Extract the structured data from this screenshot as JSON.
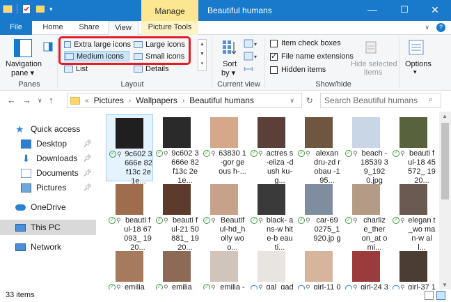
{
  "window": {
    "manage_tab": "Manage",
    "title": "Beautiful humans",
    "minimize": "—",
    "maximize": "☐",
    "close": "✕"
  },
  "tabs": {
    "file": "File",
    "home": "Home",
    "share": "Share",
    "view": "View",
    "picture_tools": "Picture Tools"
  },
  "ribbon": {
    "navigation_pane": "Navigation",
    "navigation_pane_2": "pane ▾",
    "panes_group": "Panes",
    "layout_items": {
      "extra_large_icons": "Extra large icons",
      "large_icons": "Large icons",
      "medium_icons": "Medium icons",
      "small_icons": "Small icons",
      "list": "List",
      "details": "Details"
    },
    "layout_group": "Layout",
    "sort_by": "Sort",
    "sort_by_2": "by ▾",
    "current_view_group": "Current view",
    "item_check_boxes": "Item check boxes",
    "file_name_extensions": "File name extensions",
    "hidden_items": "Hidden items",
    "hide_selected": "Hide selected",
    "hide_selected_2": "items",
    "show_hide_group": "Show/hide",
    "options": "Options",
    "options_arrow": "▾",
    "checks": {
      "item_check_boxes": false,
      "file_name_extensions": true,
      "hidden_items": false
    }
  },
  "address": {
    "prefix": "«",
    "crumbs": [
      "Pictures",
      "Wallpapers",
      "Beautiful humans"
    ],
    "search_placeholder": "Search Beautiful humans"
  },
  "nav": {
    "quick_access": "Quick access",
    "desktop": "Desktop",
    "downloads": "Downloads",
    "documents": "Documents",
    "pictures": "Pictures",
    "onedrive": "OneDrive",
    "this_pc": "This PC",
    "network": "Network"
  },
  "files": [
    {
      "name": "9c602 3666e 82f13c 2e1e...",
      "status": "ok",
      "color": "#1f1f1f"
    },
    {
      "name": "9c602 3666e 82f13c 2e1e...",
      "status": "ok",
      "color": "#2a2a2a"
    },
    {
      "name": "63830 1-gor geous h-...",
      "status": "ok",
      "color": "#d4a889"
    },
    {
      "name": "actres s-eliza -dush ku-g...",
      "status": "ok",
      "color": "#5a4038"
    },
    {
      "name": "alexan dru-zd robau -195...",
      "status": "ok",
      "color": "#6e5641"
    },
    {
      "name": "beach -18539 39_192 0.jpg",
      "status": "ok",
      "color": "#c9d6e6"
    },
    {
      "name": "beauti ful-18 45572_ 1920...",
      "status": "ok",
      "color": "#58623d"
    },
    {
      "name": "beauti ful-18 67093_ 1920...",
      "status": "ok",
      "color": "#9e6d4e"
    },
    {
      "name": "beauti ful-21 50881_ 1920...",
      "status": "ok",
      "color": "#5c3a2c"
    },
    {
      "name": "Beautif ul-hd_holly woo...",
      "status": "ok",
      "color": "#c7a28b"
    },
    {
      "name": "black- ans-w hite-b eauti...",
      "status": "ok",
      "color": "#3a3a3a"
    },
    {
      "name": "car-69 0275_1 920.jp g",
      "status": "ok",
      "color": "#7f8e9e"
    },
    {
      "name": "charliz e_ther on_at omi...",
      "status": "ok",
      "color": "#b49b86"
    },
    {
      "name": "elegan t_wo man-w all...",
      "status": "ok",
      "color": "#6a5a52"
    },
    {
      "name": "emilia _clark",
      "status": "ok",
      "color": "#a67a5c"
    },
    {
      "name": "emilia _clark",
      "status": "ok",
      "color": "#8d6a55"
    },
    {
      "name": "emilia -clark",
      "status": "ok",
      "color": "#d2c4b8"
    },
    {
      "name": "gal_gad ot_5k",
      "status": "cloud",
      "color": "#e8e4e0"
    },
    {
      "name": "girl-11 07329_",
      "status": "cloud",
      "color": "#d6b59c"
    },
    {
      "name": "girl-24 36545_",
      "status": "cloud",
      "color": "#9c3b3b"
    },
    {
      "name": "girl-37 13107_",
      "status": "cloud",
      "color": "#4b3d33"
    }
  ],
  "status": {
    "count": "33 items"
  },
  "colors": {
    "accent": "#1979ca",
    "manage": "#fbe691",
    "highlight": "#e31c25"
  }
}
